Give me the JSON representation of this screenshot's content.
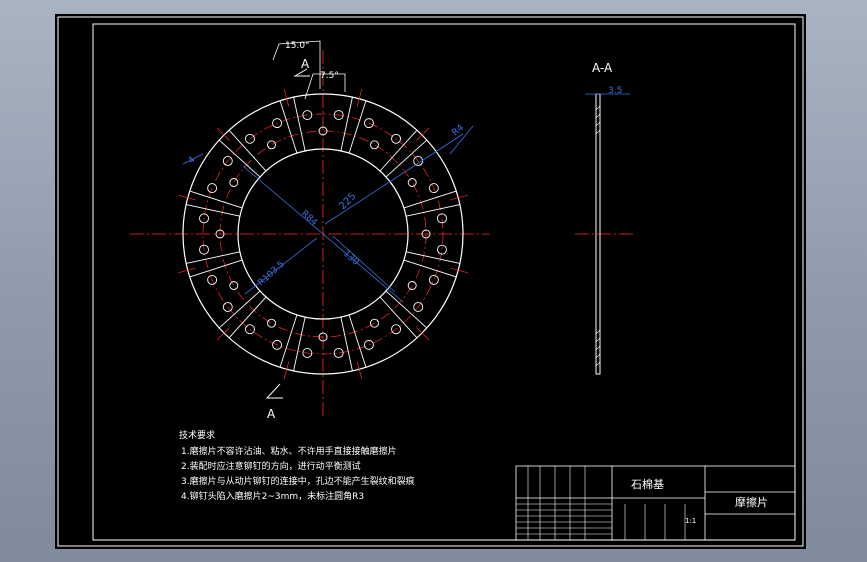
{
  "section_marker": {
    "letter_top": "A",
    "letter_bottom": "A"
  },
  "section_view": {
    "title": "A-A",
    "thickness": "3.5"
  },
  "dimensions": {
    "angle_15": "15.0°",
    "angle_7_5": "7.5°",
    "r4": "R4",
    "left_4": "4",
    "d225": "225",
    "r84": "R84",
    "d130": "130",
    "r103_5": "R103.5"
  },
  "notes": {
    "heading": "技术要求",
    "lines": [
      "1.磨擦片不容许沾油、粘水、不许用手直接接触磨擦片",
      "2.装配时应注意铆钉的方向，进行动平衡测试",
      "3.磨擦片与从动片铆钉的连接中，孔边不能产生裂纹和裂痕",
      "4.铆钉头陷入磨擦片2~3mm，未标注圆角R3"
    ]
  },
  "title_block": {
    "material": "石棉基",
    "part_name": "摩擦片",
    "scale": "1:1"
  },
  "colors": {
    "background_sheet": "#000000",
    "line": "#ffffff",
    "centerline": "#ff2a2a",
    "dimension": "#3b6fe0"
  }
}
